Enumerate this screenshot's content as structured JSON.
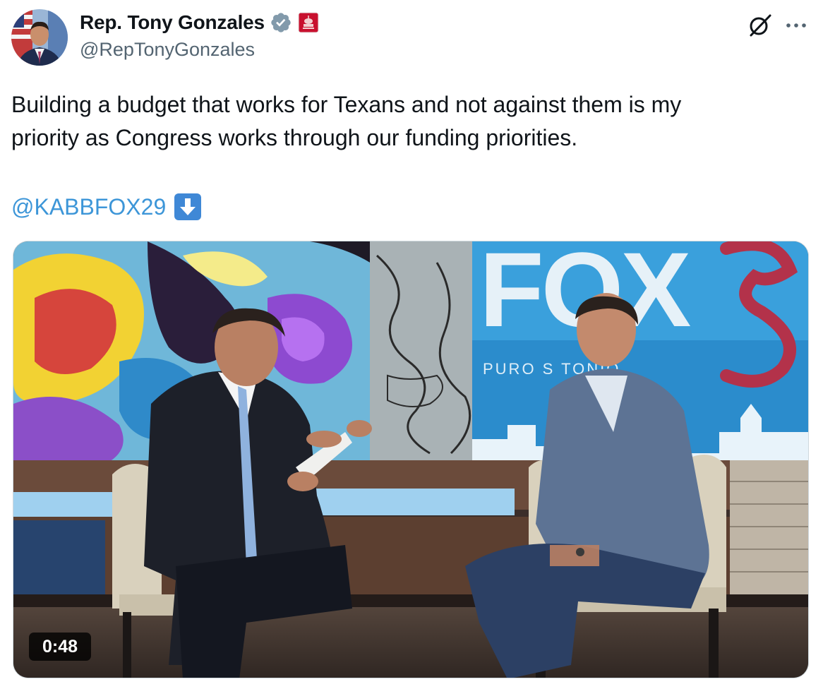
{
  "author": {
    "display_name": "Rep. Tony Gonzales",
    "handle": "@RepTonyGonzales",
    "verified_icon": "gray-verified-badge-icon",
    "affiliation_icon": "us-house-badge-icon"
  },
  "actions": {
    "grok_icon": "grok-icon",
    "more_icon": "more-horizontal-icon"
  },
  "tweet": {
    "text_line_1": "Building a budget that works for Texans and not against them is my",
    "text_line_2": "priority as Congress works through our funding priorities.",
    "mention": "@KABBFOX29",
    "emoji": "down-arrow-emoji-icon"
  },
  "video": {
    "duration": "0:48",
    "backdrop_logo": "FOX",
    "backdrop_tagline": "PURO S  TONIO"
  },
  "colors": {
    "text": "#0f1419",
    "secondary": "#536471",
    "link": "#3d96d8",
    "verified": "#829aab",
    "affiliation": "#c8102e"
  }
}
